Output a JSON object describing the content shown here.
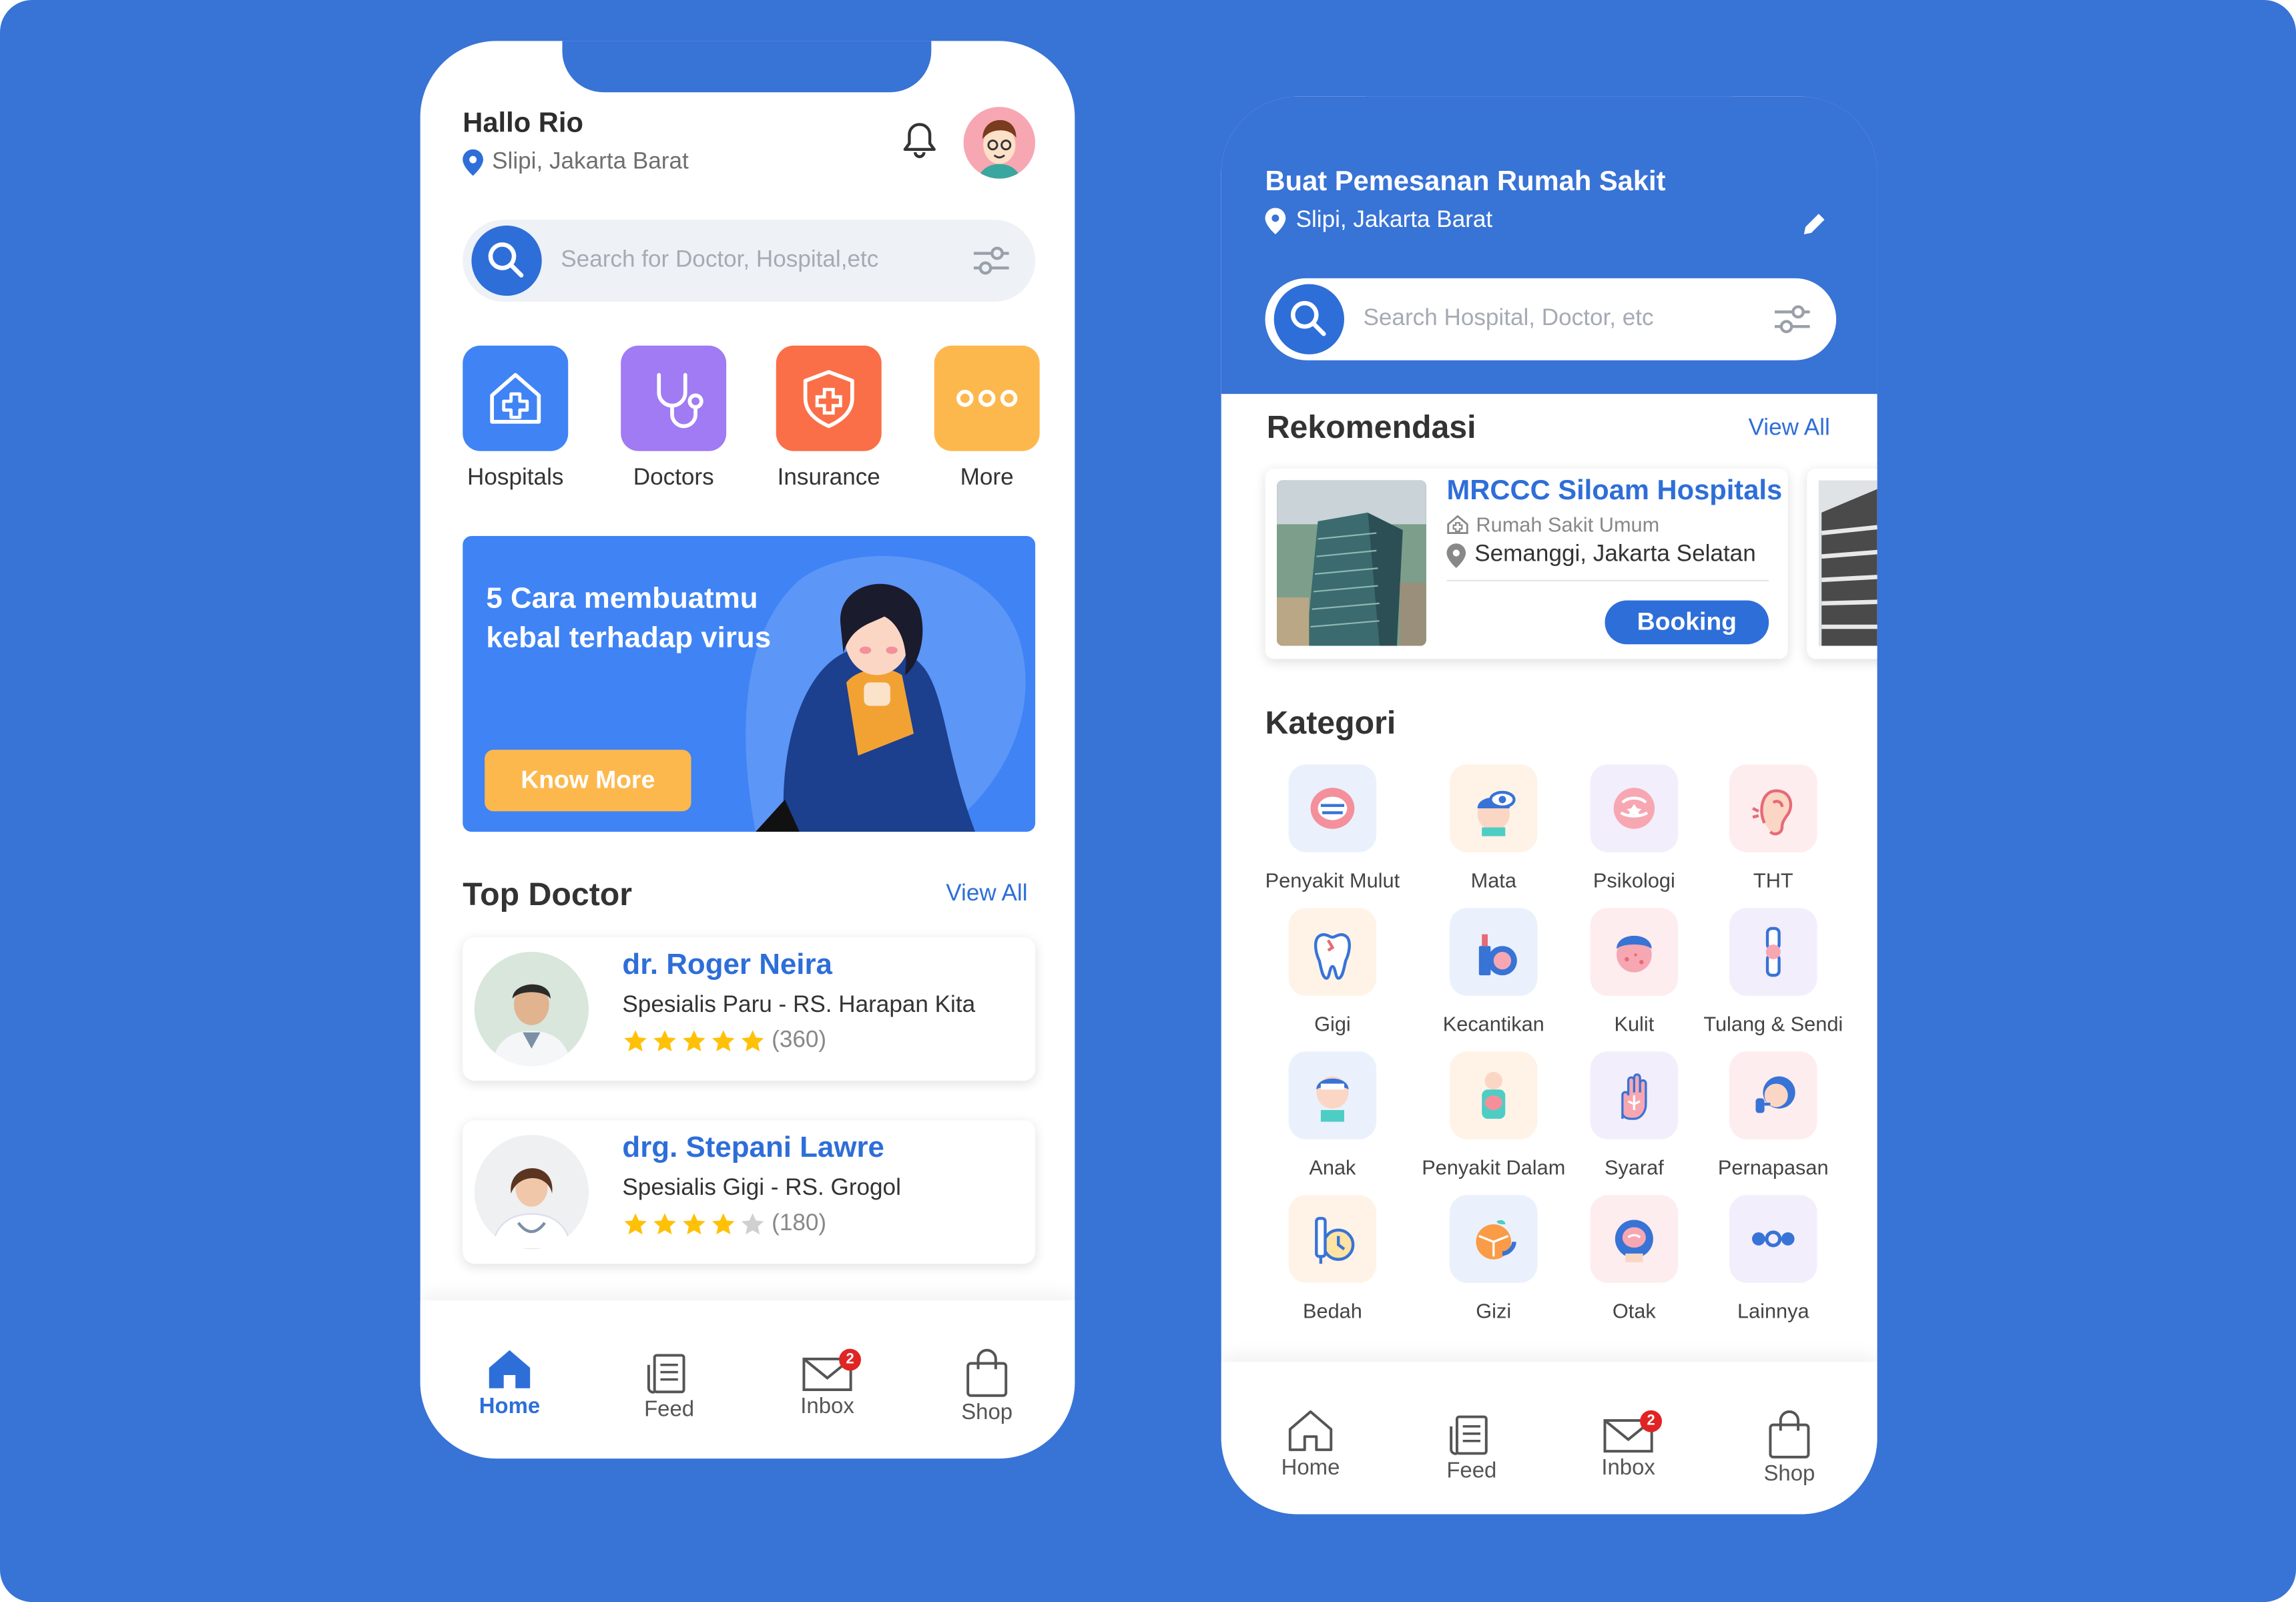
{
  "phone_home": {
    "greeting": "Hallo Rio",
    "location": "Slipi, Jakarta Barat",
    "search_placeholder": "Search for Doctor, Hospital,etc",
    "categories": [
      {
        "label": "Hospitals",
        "icon": "hospital-icon",
        "color": "#3F83F5"
      },
      {
        "label": "Doctors",
        "icon": "stethoscope-icon",
        "color": "#A07BF3"
      },
      {
        "label": "Insurance",
        "icon": "shield-icon",
        "color": "#FA6F47"
      },
      {
        "label": "More",
        "icon": "more-dots-icon",
        "color": "#FDB84D"
      }
    ],
    "banner": {
      "title": "5 Cara membuatmu kebal terhadap virus",
      "button": "Know More"
    },
    "top_doctor": {
      "heading": "Top Doctor",
      "view_all": "View All",
      "doctors": [
        {
          "name": "dr. Roger Neira",
          "specialty": "Spesialis Paru - RS. Harapan Kita",
          "stars": 5,
          "reviews": "(360)"
        },
        {
          "name": "drg. Stepani Lawre",
          "specialty": "Spesialis Gigi - RS. Grogol",
          "stars": 4,
          "reviews": "(180)"
        }
      ]
    },
    "nav": [
      {
        "label": "Home",
        "icon": "home-icon",
        "active": true
      },
      {
        "label": "Feed",
        "icon": "feed-icon",
        "active": false
      },
      {
        "label": "Inbox",
        "icon": "inbox-icon",
        "active": false,
        "badge": "2"
      },
      {
        "label": "Shop",
        "icon": "shop-icon",
        "active": false
      }
    ]
  },
  "phone_booking": {
    "title": "Buat Pemesanan Rumah Sakit",
    "location": "Slipi, Jakarta Barat",
    "search_placeholder": "Search Hospital, Doctor, etc",
    "recommendation": {
      "heading": "Rekomendasi",
      "view_all": "View All",
      "hospital": {
        "name": "MRCCC Siloam Hospitals",
        "type": "Rumah Sakit Umum",
        "location": "Semanggi, Jakarta Selatan",
        "button": "Booking"
      }
    },
    "kategori": {
      "heading": "Kategori",
      "items": [
        {
          "label": "Penyakit Mulut",
          "icon": "mouth-icon"
        },
        {
          "label": "Mata",
          "icon": "eye-icon"
        },
        {
          "label": "Psikologi",
          "icon": "brain-icon"
        },
        {
          "label": "THT",
          "icon": "ear-icon"
        },
        {
          "label": "Gigi",
          "icon": "tooth-icon"
        },
        {
          "label": "Kecantikan",
          "icon": "cosmetics-icon"
        },
        {
          "label": "Kulit",
          "icon": "skin-icon"
        },
        {
          "label": "Tulang & Sendi",
          "icon": "bone-joint-icon"
        },
        {
          "label": "Anak",
          "icon": "child-icon"
        },
        {
          "label": "Penyakit Dalam",
          "icon": "internal-organ-icon"
        },
        {
          "label": "Syaraf",
          "icon": "nerve-hand-icon"
        },
        {
          "label": "Pernapasan",
          "icon": "respiratory-icon"
        },
        {
          "label": "Bedah",
          "icon": "surgery-icon"
        },
        {
          "label": "Gizi",
          "icon": "nutrition-icon"
        },
        {
          "label": "Otak",
          "icon": "head-brain-icon"
        },
        {
          "label": "Lainnya",
          "icon": "more-dots-icon"
        }
      ]
    },
    "nav": [
      {
        "label": "Home",
        "icon": "home-icon",
        "active": false
      },
      {
        "label": "Feed",
        "icon": "feed-icon",
        "active": false
      },
      {
        "label": "Inbox",
        "icon": "inbox-icon",
        "active": false,
        "badge": "2"
      },
      {
        "label": "Shop",
        "icon": "shop-icon",
        "active": false
      }
    ]
  },
  "colors": {
    "background": "#3873D6",
    "primary": "#2E6ED8",
    "star": "#FFC107",
    "badge": "#E02424"
  }
}
